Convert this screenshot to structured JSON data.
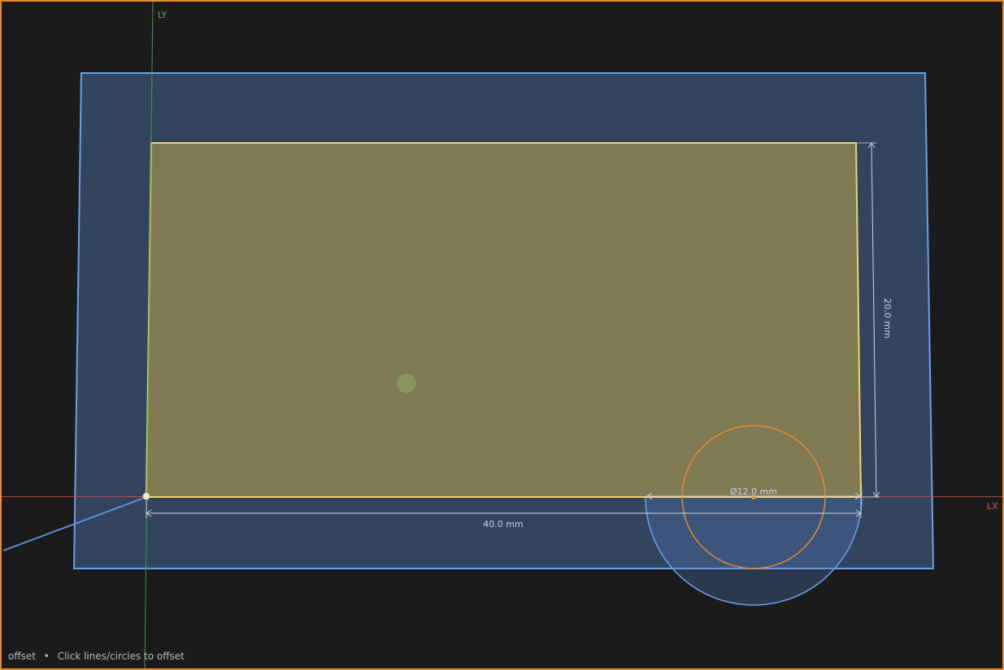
{
  "viewport": {
    "background": "#1b1b1b",
    "border_color": "#e98a2e"
  },
  "axes": {
    "x_label": "LX",
    "y_label": "LY",
    "x_color": "#d9534f",
    "y_color": "#4caf50"
  },
  "shapes": {
    "offset_boundary_color": "#6aa0e8",
    "rectangle_fill": "#7f7a52",
    "rectangle_stroke": "#f2d46b",
    "circle_stroke": "#e58a3a"
  },
  "dimensions": {
    "width_label": "40.0 mm",
    "height_label": "20.0 mm",
    "diameter_label": "Ø12.0 mm"
  },
  "status": {
    "tool": "offset",
    "separator": "•",
    "hint": "Click lines/circles to offset"
  }
}
